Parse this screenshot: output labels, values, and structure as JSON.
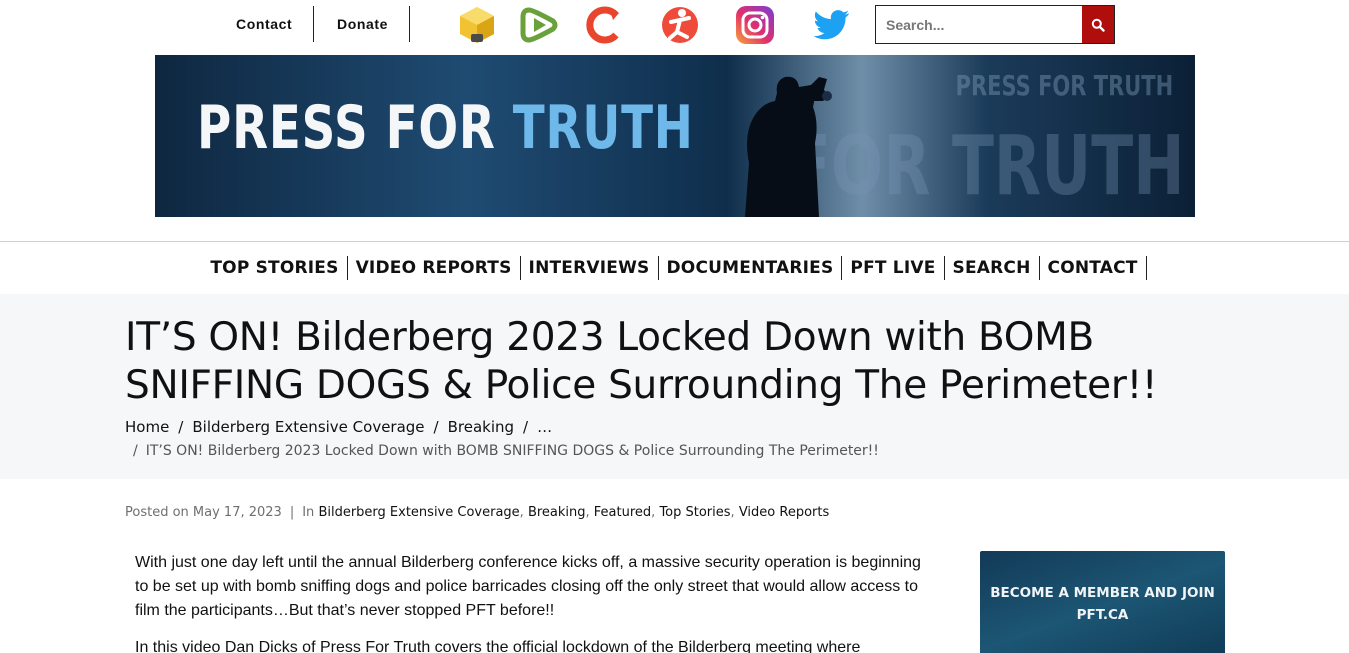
{
  "topbar": {
    "contact_label": "Contact",
    "donate_label": "Donate",
    "social": [
      {
        "icon": "locals-icon",
        "color": "#f1c232"
      },
      {
        "icon": "rumble-icon",
        "color": "#6aa13a"
      },
      {
        "icon": "odysee-icon",
        "color": "#e8452c"
      },
      {
        "icon": "odysee-alt-icon",
        "color": "#ef4b3b"
      },
      {
        "icon": "instagram-icon",
        "color": "#c13584"
      },
      {
        "icon": "twitter-icon",
        "color": "#1da1f2"
      }
    ],
    "search_placeholder": "Search...",
    "search_button_color": "#b00d0d"
  },
  "banner": {
    "logo_part1": "PRESS FOR ",
    "logo_part2": "TRUTH",
    "ghost_large": "FOR TRUTH",
    "ghost_small": "PRESS FOR TRUTH"
  },
  "nav": {
    "items": [
      "TOP STORIES",
      "VIDEO REPORTS",
      "INTERVIEWS",
      "DOCUMENTARIES",
      "PFT LIVE",
      "SEARCH",
      "CONTACT"
    ]
  },
  "post": {
    "title": "IT’S ON! Bilderberg 2023 Locked Down with BOMB SNIFFING DOGS & Police Surrounding The Perimeter!!",
    "breadcrumbs": [
      "Home",
      "Bilderberg Extensive Coverage",
      "Breaking",
      "…"
    ],
    "breadcrumb_current": "IT’S ON! Bilderberg 2023 Locked Down with BOMB SNIFFING DOGS & Police Surrounding The Perimeter!!",
    "meta": {
      "posted_on_label": "Posted on",
      "date": "May 17, 2023",
      "in_label": "In",
      "categories": [
        "Bilderberg Extensive Coverage",
        "Breaking",
        "Featured",
        "Top Stories",
        "Video Reports"
      ]
    },
    "paragraphs": [
      "With just one day left until the annual Bilderberg conference kicks off, a massive security operation is beginning to be set up with bomb sniffing dogs and police barricades closing off the only street that would allow access to film the participants…But that’s never stopped PFT before!!",
      "In this video Dan Dicks of Press For Truth covers the official lockdown of the Bilderberg meeting where"
    ]
  },
  "sidebar": {
    "promo_line1": "BECOME A MEMBER AND JOIN",
    "promo_line2": "PFT.CA"
  }
}
